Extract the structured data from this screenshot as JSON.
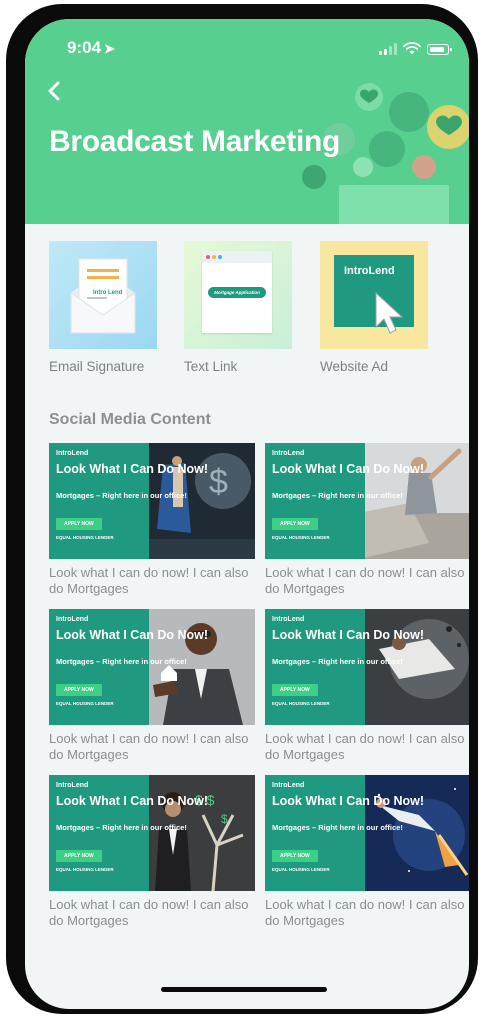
{
  "status_bar": {
    "time": "9:04"
  },
  "header": {
    "title": "Broadcast Marketing"
  },
  "tools": [
    {
      "label": "Email Signature",
      "brand": "Intro Lend"
    },
    {
      "label": "Text Link",
      "button_text": "Mortgage Application"
    },
    {
      "label": "Website Ad",
      "brand": "IntroLend"
    }
  ],
  "social_section": {
    "title": "Social Media Content"
  },
  "social_items": [
    {
      "brand": "IntroLend",
      "headline": "Look What I Can Do Now!",
      "subline": "Mortgages – Right here in our office!",
      "button": "APPLY NOW",
      "lender": "EQUAL HOUSING LENDER",
      "caption": "Look what I can do now! I can also do Mortgages"
    },
    {
      "brand": "IntroLend",
      "headline": "Look What I Can Do Now!",
      "subline": "Mortgages – Right here in our office!",
      "button": "APPLY NOW",
      "lender": "EQUAL HOUSING LENDER",
      "caption": "Look what I can do now! I can also do Mortgages"
    },
    {
      "brand": "IntroLend",
      "headline": "Look What I Can Do Now!",
      "subline": "Mortgages – Right here in our office!",
      "button": "APPLY NOW",
      "lender": "EQUAL HOUSING LENDER",
      "caption": "Look what I can do now! I can also do Mortgages"
    },
    {
      "brand": "IntroLend",
      "headline": "Look What I Can Do Now!",
      "subline": "Mortgages – Right here in our office!",
      "button": "APPLY NOW",
      "lender": "EQUAL HOUSING LENDER",
      "caption": "Look what I can do now! I can also do Mortgages"
    },
    {
      "brand": "IntroLend",
      "headline": "Look What I Can Do Now!",
      "subline": "Mortgages – Right here in our office!",
      "button": "APPLY NOW",
      "lender": "EQUAL HOUSING LENDER",
      "caption": "Look what I can do now! I can also do Mortgages"
    },
    {
      "brand": "IntroLend",
      "headline": "Look What I Can Do Now!",
      "subline": "Mortgages – Right here in our office!",
      "button": "APPLY NOW",
      "lender": "EQUAL HOUSING LENDER",
      "caption": "Look what I can do now! I can also do Mortgages"
    }
  ],
  "colors": {
    "header": "#57d08f",
    "banner": "#1f9a80",
    "apply": "#3ccf85",
    "background": "#f2f5f6"
  },
  "icons": {
    "back": "chevron-left-icon",
    "signal": "signal-icon",
    "wifi": "wifi-icon",
    "battery": "battery-icon",
    "location": "location-arrow-icon"
  }
}
